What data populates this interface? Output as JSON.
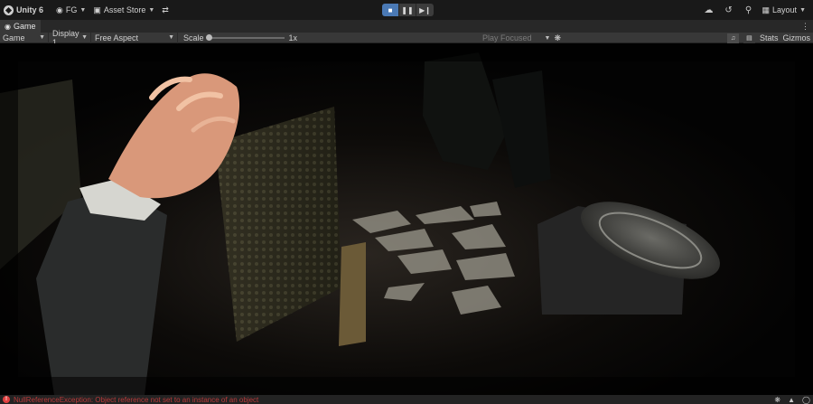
{
  "toolbar": {
    "app_name": "Unity 6",
    "account": "FG",
    "asset_store": "Asset Store",
    "layout": "Layout",
    "play_controls": [
      "play",
      "pause",
      "step"
    ]
  },
  "tab": {
    "label": "Game"
  },
  "gamebar": {
    "view_mode": "Game",
    "display": "Display 1",
    "aspect": "Free Aspect",
    "scale_label": "Scale",
    "scale_value": "1x",
    "scale_level": 0.0,
    "play_focused": "Play Focused",
    "stats": "Stats",
    "gizmos": "Gizmos"
  },
  "status": {
    "error_message": "NullReferenceException: Object reference not set to an instance of an object"
  },
  "colors": {
    "accent_play": "#4a79b5",
    "error": "#e04040",
    "toolbar_bg": "#191919"
  },
  "icons": [
    "unity-logo-icon",
    "account-icon",
    "asset-store-icon",
    "version-control-icon",
    "cloud-icon",
    "history-icon",
    "search-icon",
    "layout-icon",
    "game-icon",
    "audio-mute-icon",
    "stats-icon",
    "error-icon"
  ]
}
